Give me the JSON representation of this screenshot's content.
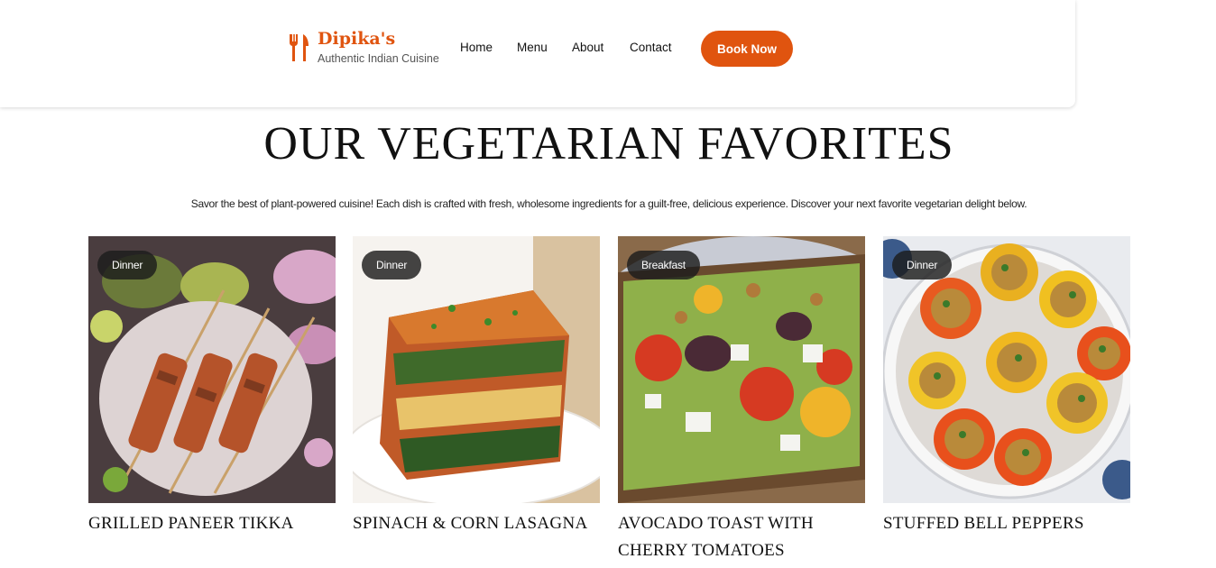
{
  "brand": {
    "name": "Dipika's",
    "tagline": "Authentic Indian Cuisine",
    "accent": "#e0540f"
  },
  "nav": {
    "links": [
      "Home",
      "Menu",
      "About",
      "Contact"
    ],
    "cta": "Book Now"
  },
  "section": {
    "title": "OUR VEGETARIAN FAVORITES",
    "description": "Savor the best of plant-powered cuisine! Each dish is crafted with fresh, wholesome ingredients for a guilt-free, delicious experience. Discover your next favorite vegetarian delight below."
  },
  "cards": [
    {
      "badge": "Dinner",
      "title": "GRILLED PANEER TIKKA"
    },
    {
      "badge": "Dinner",
      "title": "SPINACH & CORN LASAGNA"
    },
    {
      "badge": "Breakfast",
      "title": "AVOCADO TOAST WITH CHERRY TOMATOES"
    },
    {
      "badge": "Dinner",
      "title": "STUFFED BELL PEPPERS"
    }
  ]
}
